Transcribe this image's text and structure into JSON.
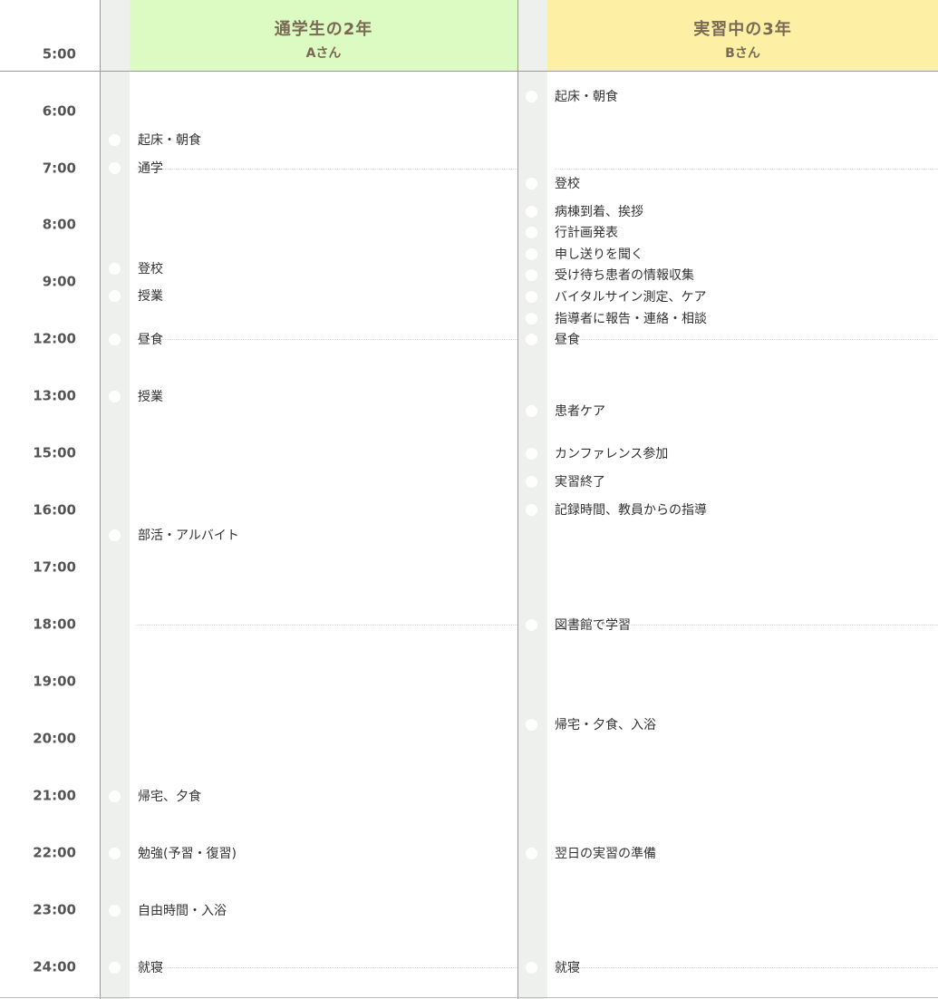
{
  "columns": [
    {
      "title": "通学生の2年",
      "subtitle": "Aさん",
      "bg": "#dcfbc2"
    },
    {
      "title": "実習中の3年",
      "subtitle": "Bさん",
      "bg": "#fdf0a5"
    }
  ],
  "times": [
    "5:00",
    "6:00",
    "7:00",
    "8:00",
    "9:00",
    "12:00",
    "13:00",
    "15:00",
    "16:00",
    "17:00",
    "18:00",
    "19:00",
    "20:00",
    "21:00",
    "22:00",
    "23:00",
    "24:00"
  ],
  "events_a": [
    "起床・朝食",
    "通学",
    "登校",
    "授業",
    "昼食",
    "授業",
    "部活・アルバイト",
    "帰宅、夕食",
    "勉強(予習・復習)",
    "自由時間・入浴",
    "就寝"
  ],
  "events_b": [
    "起床・朝食",
    "登校",
    "病棟到着、挨拶",
    "行計画発表",
    "申し送りを聞く",
    "受け待ち患者の情報収集",
    "バイタルサイン測定、ケア",
    "指導者に報告・連絡・相談",
    "昼食",
    "患者ケア",
    "カンファレンス参加",
    "実習終了",
    "記録時間、教員からの指導",
    "図書館で学習",
    "帰宅・夕食、入浴",
    "翌日の実習の準備",
    "就寝"
  ],
  "colors": {
    "gutter": "#eef0ee",
    "header_text": "#7a6a55",
    "time_text": "#555555"
  }
}
